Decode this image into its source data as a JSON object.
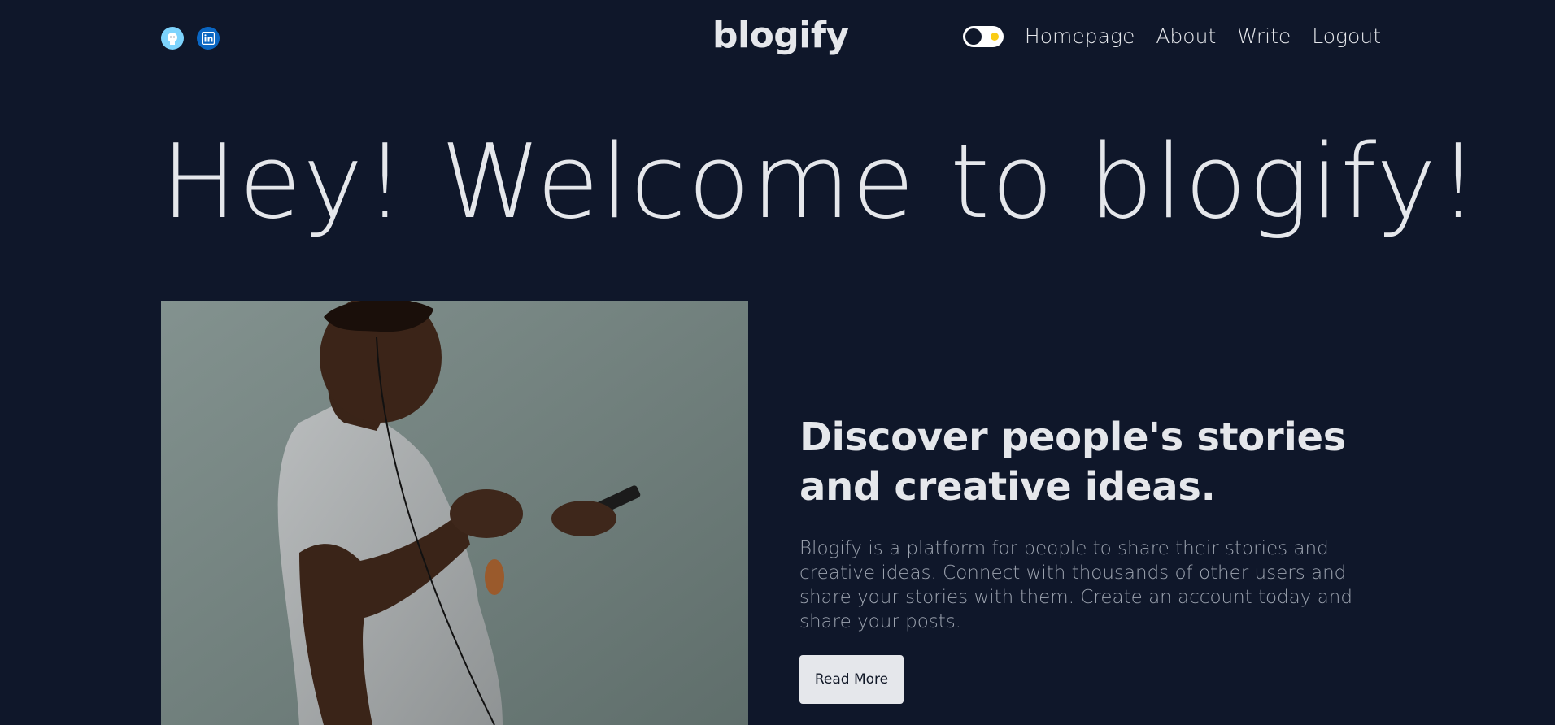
{
  "header": {
    "brand": "blogify",
    "nav": {
      "homepage": "Homepage",
      "about": "About",
      "write": "Write",
      "logout": "Logout"
    },
    "socials": [
      "github-icon",
      "linkedin-icon"
    ],
    "theme_toggle": {
      "state": "dark",
      "accent": "#facc15"
    }
  },
  "hero": {
    "title": "Hey! Welcome to blogify!"
  },
  "feature": {
    "headline": "Discover people's stories and creative ideas.",
    "description": "Blogify is a platform for people to share their stories and creative ideas. Connect with thousands of other users and share your stories with them. Create an account today and share your posts.",
    "button_label": "Read More"
  },
  "colors": {
    "background": "#0f172a",
    "text": "#e5e7eb",
    "muted": "#9ca3af"
  }
}
